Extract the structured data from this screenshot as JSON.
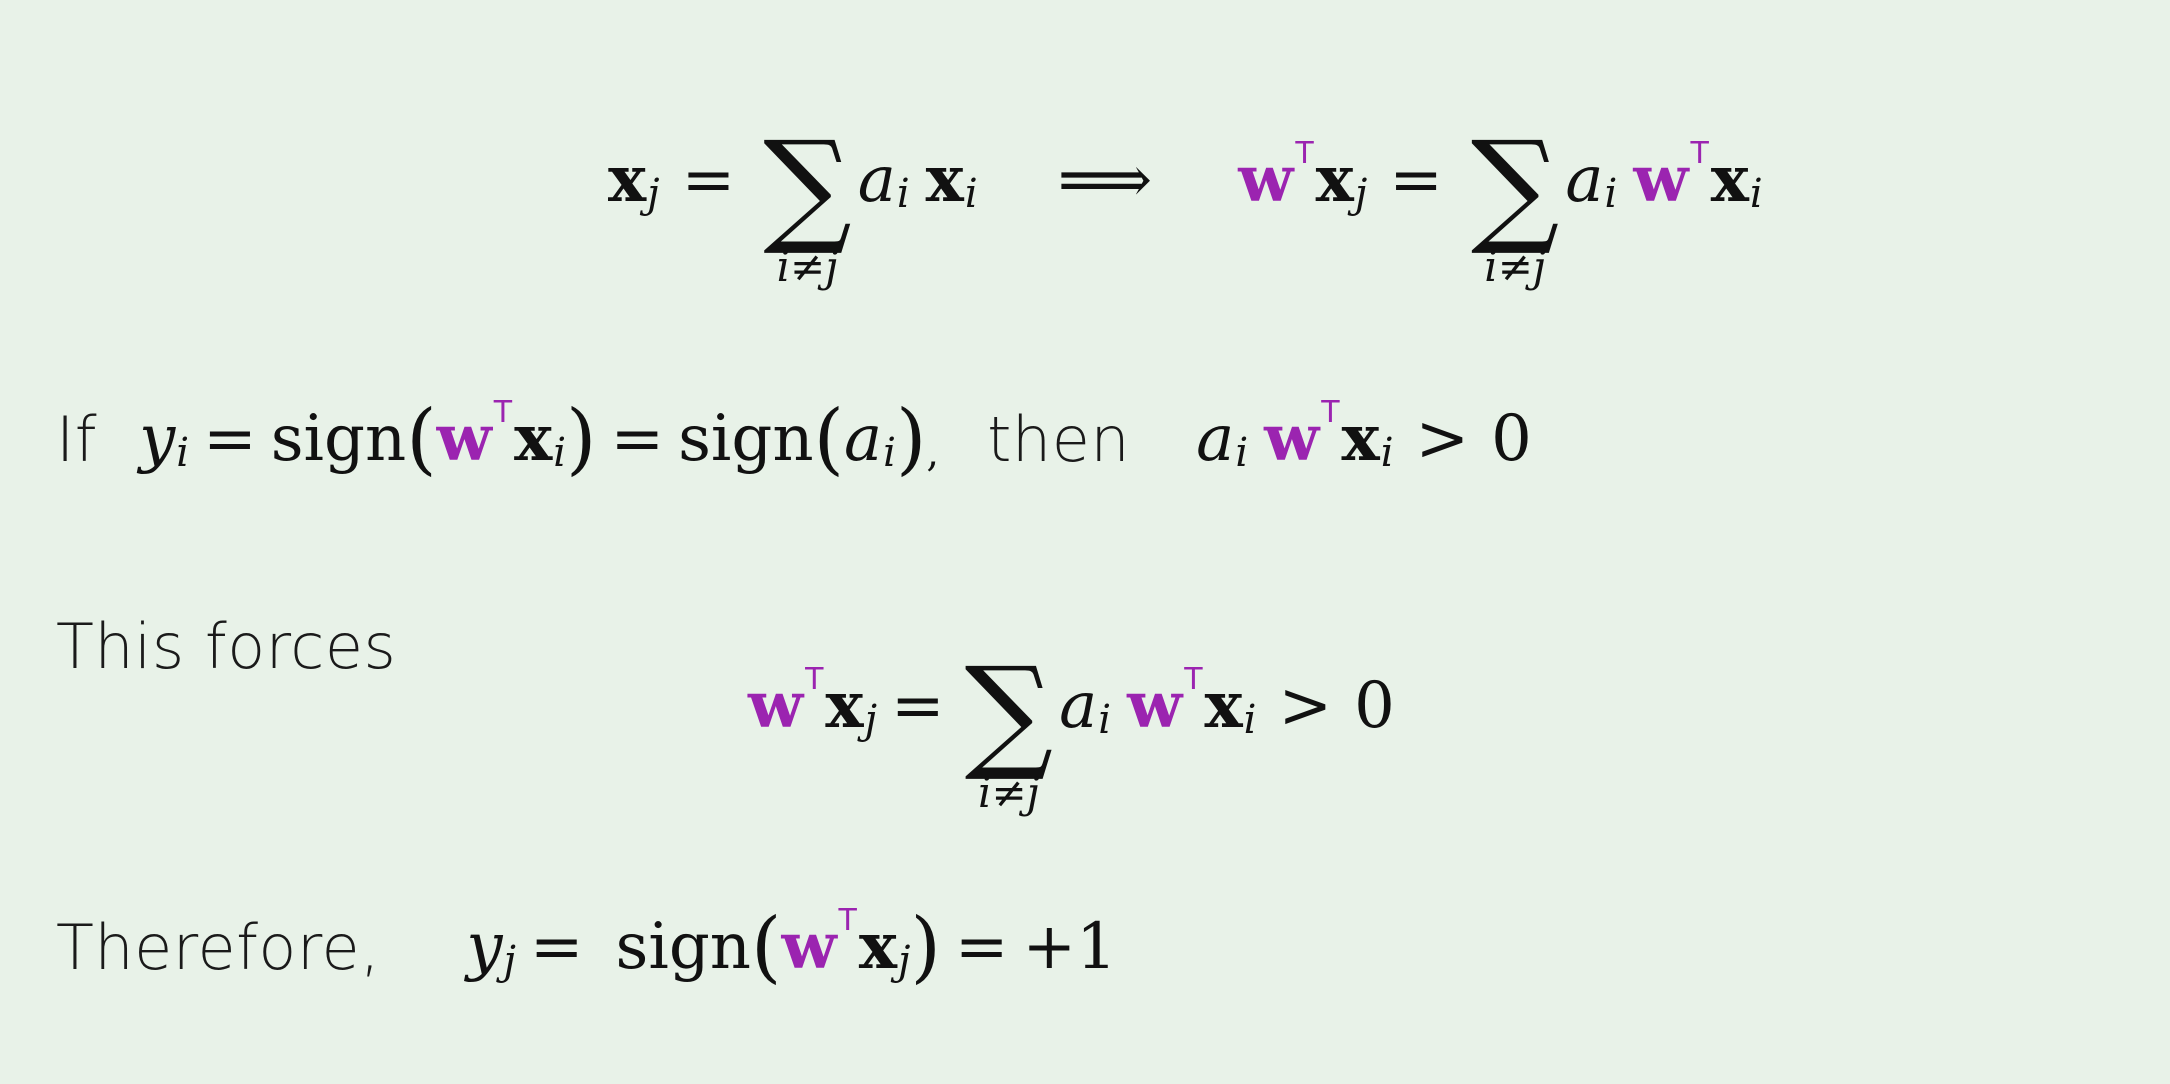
{
  "row1": {
    "x": "x",
    "j": "j",
    "eq": "=",
    "sum": "∑",
    "sum_index": "i≠j",
    "a": "a",
    "i": "i",
    "implies": "⟹",
    "w": "w",
    "T": "T"
  },
  "row2": {
    "if_label": "If",
    "then_label": "then",
    "y": "y",
    "sign": "sign",
    "gt": ">",
    "zero": "0",
    "comma": ","
  },
  "row3": {
    "label": "This forces"
  },
  "row4": {
    "label": "Therefore,",
    "result": "+1"
  },
  "colors": {
    "background": "#e8f2e8",
    "w_accent": "#9b24b0",
    "text": "#111111"
  }
}
